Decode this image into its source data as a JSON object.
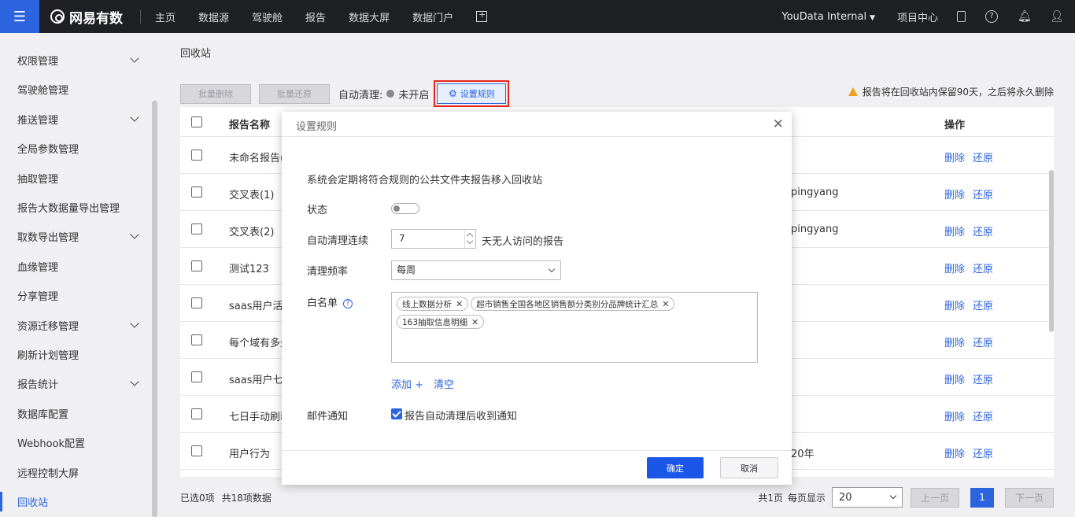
{
  "topbar": {
    "brand": "网易有数",
    "nav": [
      "主页",
      "数据源",
      "驾驶舱",
      "报告",
      "数据大屏",
      "数据门户"
    ],
    "org": "YouData Internal",
    "project_center": "项目中心"
  },
  "sidebar": {
    "items": [
      {
        "label": "权限管理",
        "has_children": true
      },
      {
        "label": "驾驶舱管理",
        "has_children": false
      },
      {
        "label": "推送管理",
        "has_children": true
      },
      {
        "label": "全局参数管理",
        "has_children": false
      },
      {
        "label": "抽取管理",
        "has_children": false
      },
      {
        "label": "报告大数据量导出管理",
        "has_children": false
      },
      {
        "label": "取数导出管理",
        "has_children": true
      },
      {
        "label": "血缘管理",
        "has_children": false
      },
      {
        "label": "分享管理",
        "has_children": false
      },
      {
        "label": "资源迁移管理",
        "has_children": true
      },
      {
        "label": "刷新计划管理",
        "has_children": false
      },
      {
        "label": "报告统计",
        "has_children": true
      },
      {
        "label": "数据库配置",
        "has_children": false
      },
      {
        "label": "Webhook配置",
        "has_children": false
      },
      {
        "label": "远程控制大屏",
        "has_children": false
      },
      {
        "label": "回收站",
        "has_children": false,
        "active": true
      }
    ]
  },
  "main": {
    "breadcrumb": "回收站",
    "batch_delete": "批量删除",
    "batch_restore": "批量还原",
    "auto_clean_label": "自动清理:",
    "auto_clean_status": "未开启",
    "set_rules": "设置规则",
    "retention_note": "报告将在回收站内保留90天，之后将永久删除",
    "table": {
      "headers": {
        "name": "报告名称",
        "ops": "操作"
      },
      "rows": [
        {
          "name": "未命名报告(",
          "extra": ""
        },
        {
          "name": "交叉表(1)",
          "extra": "pingyang"
        },
        {
          "name": "交叉表(2)",
          "extra": "pingyang"
        },
        {
          "name": "测试123",
          "extra": ""
        },
        {
          "name": "saas用户活跃",
          "extra": ""
        },
        {
          "name": "每个域有多少",
          "extra": ""
        },
        {
          "name": "saas用户七日",
          "extra": ""
        },
        {
          "name": "七日手动刷新",
          "extra": ""
        },
        {
          "name": "用户行为",
          "extra": "20年"
        }
      ],
      "op_delete": "删除",
      "op_restore": "还原"
    },
    "footer": {
      "selected": "已选0项",
      "total": "共18项数据",
      "pages": "共1页",
      "per_page_label": "每页显示",
      "per_page": "20",
      "prev": "上一页",
      "current": "1",
      "next": "下一页"
    }
  },
  "modal": {
    "title": "设置规则",
    "description": "系统会定期将符合规则的公共文件夹报告移入回收站",
    "status_label": "状态",
    "status_on": false,
    "auto_clean_label": "自动清理连续",
    "days_value": "7",
    "days_suffix": "天无人访问的报告",
    "frequency_label": "清理频率",
    "frequency_value": "每周",
    "whitelist_label": "白名单",
    "whitelist_tags": [
      "线上数据分析",
      "超市销售全国各地区销售额分类别分品牌统计汇总",
      "163抽取信息明细"
    ],
    "add": "添加 +",
    "clear": "清空",
    "email_label": "邮件通知",
    "email_checkbox": "报告自动清理后收到通知",
    "email_checked": true,
    "confirm": "确定",
    "cancel": "取消"
  }
}
